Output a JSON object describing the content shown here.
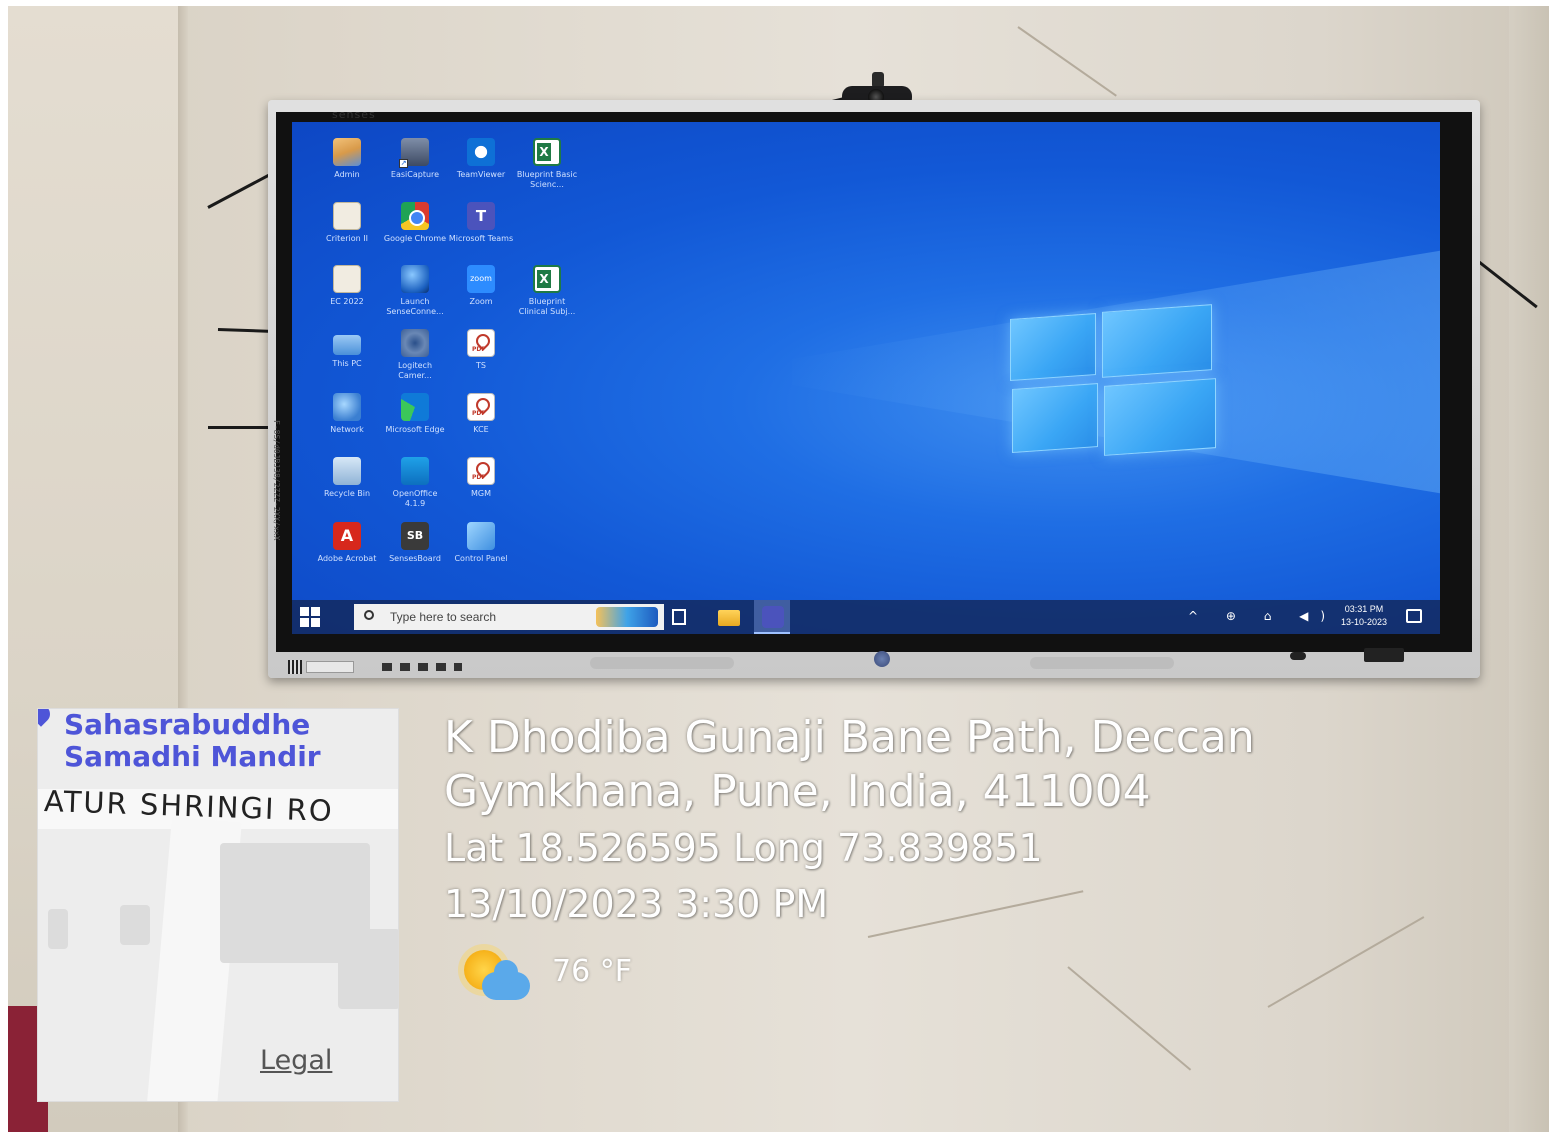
{
  "monitor": {
    "brand": "senses",
    "side_text": "F-8S/d0JBJ38/2ZZZ-2XX/xxX"
  },
  "desktop": {
    "icons": [
      {
        "label": "Admin",
        "icon": "user-icon"
      },
      {
        "label": "EasiCapture",
        "icon": "camera-icon"
      },
      {
        "label": "TeamViewer",
        "icon": "teamviewer-icon"
      },
      {
        "label": "Blueprint Basic Scienc...",
        "icon": "excel-icon"
      },
      {
        "label": "Criterion II",
        "icon": "file-icon"
      },
      {
        "label": "Google Chrome",
        "icon": "chrome-icon"
      },
      {
        "label": "Microsoft Teams",
        "icon": "teams-icon"
      },
      {
        "label": "EC 2022",
        "icon": "file-icon"
      },
      {
        "label": "Launch SenseConne...",
        "icon": "orb-icon"
      },
      {
        "label": "Zoom",
        "icon": "zoom-icon"
      },
      {
        "label": "Blueprint Clinical Subj...",
        "icon": "excel-icon"
      },
      {
        "label": "This PC",
        "icon": "pc-icon"
      },
      {
        "label": "Logitech Camer...",
        "icon": "webcam-icon"
      },
      {
        "label": "TS",
        "icon": "pdf-icon"
      },
      {
        "label": "Network",
        "icon": "network-icon"
      },
      {
        "label": "Microsoft Edge",
        "icon": "edge-icon"
      },
      {
        "label": "KCE",
        "icon": "pdf-icon"
      },
      {
        "label": "Recycle Bin",
        "icon": "recycle-bin-icon"
      },
      {
        "label": "OpenOffice 4.1.9",
        "icon": "openoffice-icon"
      },
      {
        "label": "MGM",
        "icon": "pdf-icon"
      },
      {
        "label": "Adobe Acrobat",
        "icon": "acrobat-icon"
      },
      {
        "label": "SensesBoard",
        "icon": "sensesboard-icon"
      },
      {
        "label": "Control Panel",
        "icon": "control-panel-icon"
      }
    ],
    "zoom_glyph_text": "zoom"
  },
  "taskbar": {
    "search_placeholder": "Type here to search",
    "time": "03:31 PM",
    "date": "13-10-2023",
    "tray": "^ ⊕ ⌂ ◀)"
  },
  "map": {
    "place_name_line1": "Sahasrabuddhe",
    "place_name_line2": "Samadhi Mandir",
    "road_label": "ATUR SHRINGI RO",
    "legal": "Legal"
  },
  "stamp": {
    "address_line1": "K Dhodiba Gunaji Bane Path, Deccan",
    "address_line2": "Gymkhana, Pune, India, 411004",
    "coordinates": "Lat 18.526595 Long 73.839851",
    "datetime": "13/10/2023 3:30 PM",
    "temperature": "76 °F",
    "weather_icon": "partly-sunny-icon"
  }
}
